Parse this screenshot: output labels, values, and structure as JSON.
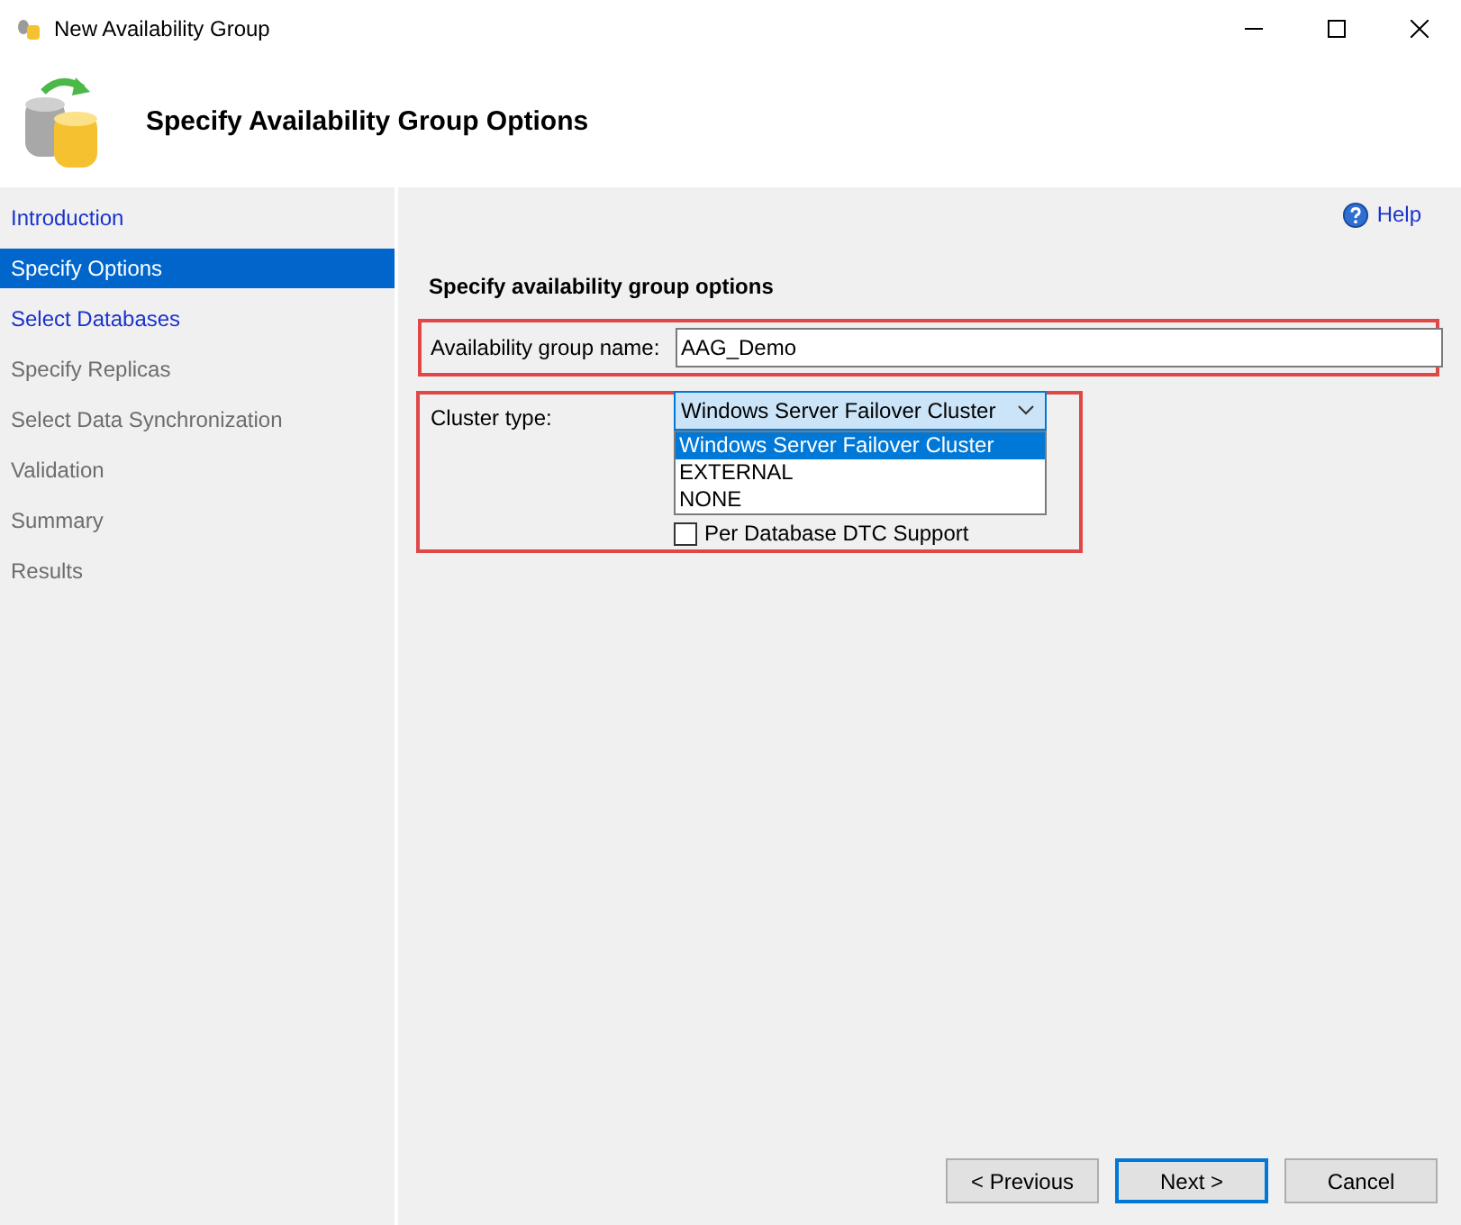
{
  "window": {
    "title": "New Availability Group"
  },
  "header": {
    "title": "Specify Availability Group Options"
  },
  "sidebar": {
    "items": [
      {
        "label": "Introduction",
        "selected": false,
        "disabled": false
      },
      {
        "label": "Specify Options",
        "selected": true,
        "disabled": false
      },
      {
        "label": "Select Databases",
        "selected": false,
        "disabled": false
      },
      {
        "label": "Specify Replicas",
        "selected": false,
        "disabled": true
      },
      {
        "label": "Select Data Synchronization",
        "selected": false,
        "disabled": true
      },
      {
        "label": "Validation",
        "selected": false,
        "disabled": true
      },
      {
        "label": "Summary",
        "selected": false,
        "disabled": true
      },
      {
        "label": "Results",
        "selected": false,
        "disabled": true
      }
    ]
  },
  "help": "Help",
  "section_title": "Specify availability group options",
  "name_field": {
    "label": "Availability group name:",
    "value": "AAG_Demo"
  },
  "cluster_type": {
    "label": "Cluster type:",
    "value": "Windows Server Failover Cluster",
    "expanded": true,
    "options": [
      {
        "label": "Windows Server Failover Cluster",
        "selected": true
      },
      {
        "label": "EXTERNAL",
        "selected": false
      },
      {
        "label": "NONE",
        "selected": false
      }
    ]
  },
  "dtc_checkbox": {
    "label": "Per Database DTC Support",
    "checked": false
  },
  "buttons": [
    {
      "label": "< Previous",
      "default": false
    },
    {
      "label": "Next >",
      "default": true
    },
    {
      "label": "Cancel",
      "default": false
    }
  ]
}
